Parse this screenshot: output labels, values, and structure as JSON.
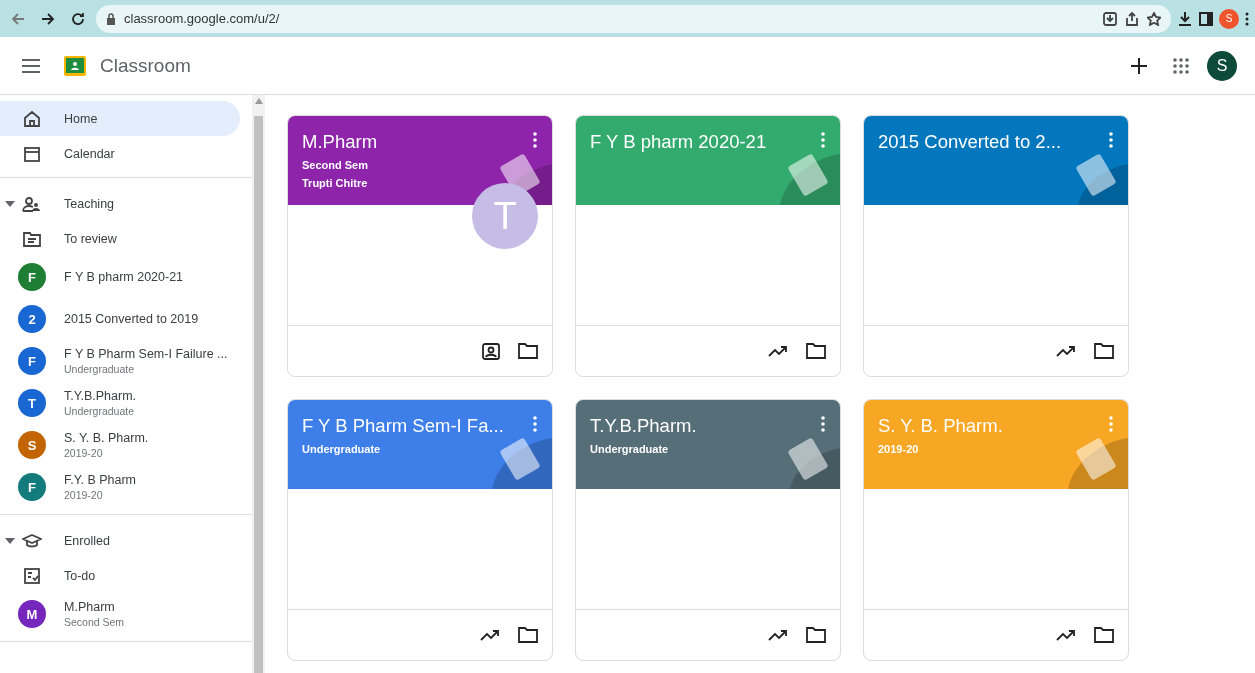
{
  "browser": {
    "url": "classroom.google.com/u/2/",
    "profile_initial": "S"
  },
  "app": {
    "title": "Classroom",
    "account_initial": "S"
  },
  "sidebar": {
    "groups": [
      {
        "items": [
          {
            "kind": "home",
            "label": "Home",
            "selected": true
          },
          {
            "kind": "calendar",
            "label": "Calendar",
            "selected": false
          }
        ]
      },
      {
        "header": {
          "kind": "teaching",
          "label": "Teaching",
          "expanded": true
        },
        "items": [
          {
            "kind": "review",
            "label": "To review",
            "selected": false
          },
          {
            "kind": "class",
            "label": "F Y B pharm 2020-21",
            "initial": "F",
            "color": "#1e7e34",
            "selected": false
          },
          {
            "kind": "class",
            "label": "2015 Converted to 2019",
            "initial": "2",
            "color": "#1967d2",
            "selected": false
          },
          {
            "kind": "class",
            "label": "F Y B Pharm Sem-I Failure ...",
            "subtitle": "Undergraduate",
            "initial": "F",
            "color": "#1967d2",
            "selected": false
          },
          {
            "kind": "class",
            "label": "T.Y.B.Pharm.",
            "subtitle": "Undergraduate",
            "initial": "T",
            "color": "#1967d2",
            "selected": false
          },
          {
            "kind": "class",
            "label": "S. Y. B. Pharm.",
            "subtitle": "2019-20",
            "initial": "S",
            "color": "#c26401",
            "selected": false
          },
          {
            "kind": "class",
            "label": "F.Y. B Pharm",
            "subtitle": "2019-20",
            "initial": "F",
            "color": "#137b7b",
            "selected": false
          }
        ]
      },
      {
        "header": {
          "kind": "enrolled",
          "label": "Enrolled",
          "expanded": true
        },
        "items": [
          {
            "kind": "todo",
            "label": "To-do",
            "selected": false
          },
          {
            "kind": "class",
            "label": "M.Pharm",
            "subtitle": "Second Sem",
            "initial": "M",
            "color": "#7627bb",
            "selected": false
          }
        ]
      }
    ]
  },
  "cards": [
    {
      "kind": "enrolled",
      "title": "M.Pharm",
      "subtitle": "Second Sem",
      "teacher": "Trupti Chitre",
      "avatar": "T",
      "color": "#8e24aa"
    },
    {
      "kind": "teaching",
      "title": "F Y B pharm 2020-21",
      "color": "#34ab6e"
    },
    {
      "kind": "teaching",
      "title": "2015 Converted to 2...",
      "color": "#0277bd"
    },
    {
      "kind": "teaching",
      "title": "F Y B Pharm Sem-I Fa...",
      "subtitle": "Undergraduate",
      "color": "#3e7ee8"
    },
    {
      "kind": "teaching",
      "title": "T.Y.B.Pharm.",
      "subtitle": "Undergraduate",
      "color": "#566e78"
    },
    {
      "kind": "teaching",
      "title": "S. Y. B. Pharm.",
      "subtitle": "2019-20",
      "color": "#f8a724"
    }
  ]
}
